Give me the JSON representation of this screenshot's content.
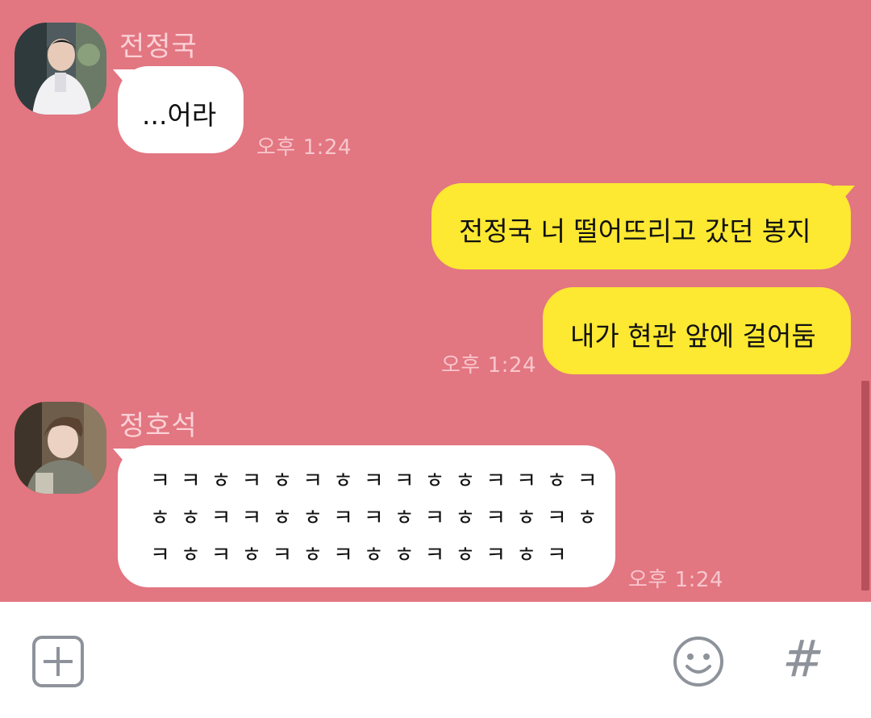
{
  "messages": [
    {
      "sender": "전정국",
      "avatar": "avatar-jungkook",
      "text": "...어라",
      "time": "오후 1:24"
    },
    {
      "sender": "me",
      "texts": [
        "전정국 너 떨어뜨리고 갔던 봉지",
        "내가 현관 앞에 걸어둠"
      ],
      "time": "오후 1:24"
    },
    {
      "sender": "정호석",
      "avatar": "avatar-hoseok",
      "lines": [
        "ㅋㅋㅎㅋㅎㅋㅎㅋㅋㅎㅎㅋㅋㅎㅋ",
        "ㅎㅎㅋㅋㅎㅎㅋㅋㅎㅋㅎㅋㅎㅋㅎ",
        "ㅋㅎㅋㅎㅋㅎㅋㅎㅎㅋㅎㅋㅎㅋ"
      ],
      "time": "오후 1:24"
    }
  ],
  "input_bar": {
    "left_icon": "plus-square-icon",
    "emoji_icon": "smiley-icon",
    "hash_icon": "hash-icon",
    "hash_label": "#"
  },
  "colors": {
    "chat_background": "#e27681",
    "my_bubble": "#fde832",
    "other_bubble": "#ffffff"
  }
}
